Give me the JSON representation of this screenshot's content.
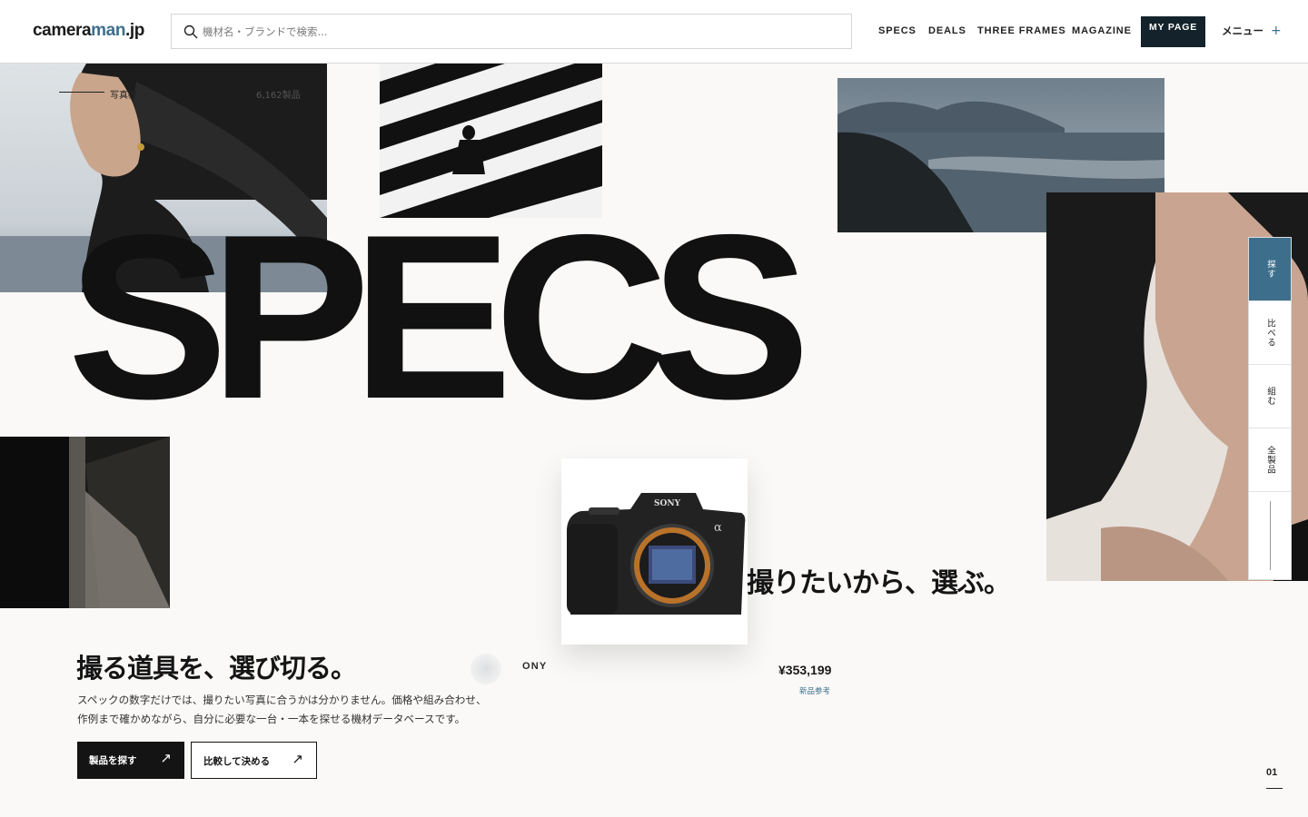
{
  "header": {
    "logo_main": "camera",
    "logo_accent": "man",
    "logo_tld": ".jp",
    "search_placeholder": "機材名・ブランドで検索...",
    "nav": [
      "SPECS",
      "DEALS",
      "THREE FRAMES",
      "MAGAZINE"
    ],
    "mypage_label": "MY PAGE",
    "menu_label": "メニュー",
    "menu_icon": "+"
  },
  "hero": {
    "category_label": "写真機",
    "product_count": "6,162製品",
    "headline": "SPECS",
    "tagline": "撮りたいから、選ぶ。"
  },
  "featured": {
    "brand": "ONY",
    "price": "¥353,199",
    "price_note": "新品参考"
  },
  "lead": {
    "title": "撮る道具を、選び切る。",
    "body_line1": "スペックの数字だけでは、撮りたい写真に合うかは分かりません。価格や組み合わせ、",
    "body_line2": "作例まで確かめながら、自分に必要な一台・一本を探せる機材データベースです。",
    "primary_button": "製品を探す",
    "secondary_button": "比較して決める",
    "button_arrow": "↗"
  },
  "rail": {
    "items": [
      "探す",
      "比べる",
      "組む",
      "全製品"
    ]
  },
  "pagination": {
    "current": "01"
  },
  "colors": {
    "accent": "#3d6f8c",
    "ink": "#141414",
    "background": "#faf9f7"
  }
}
